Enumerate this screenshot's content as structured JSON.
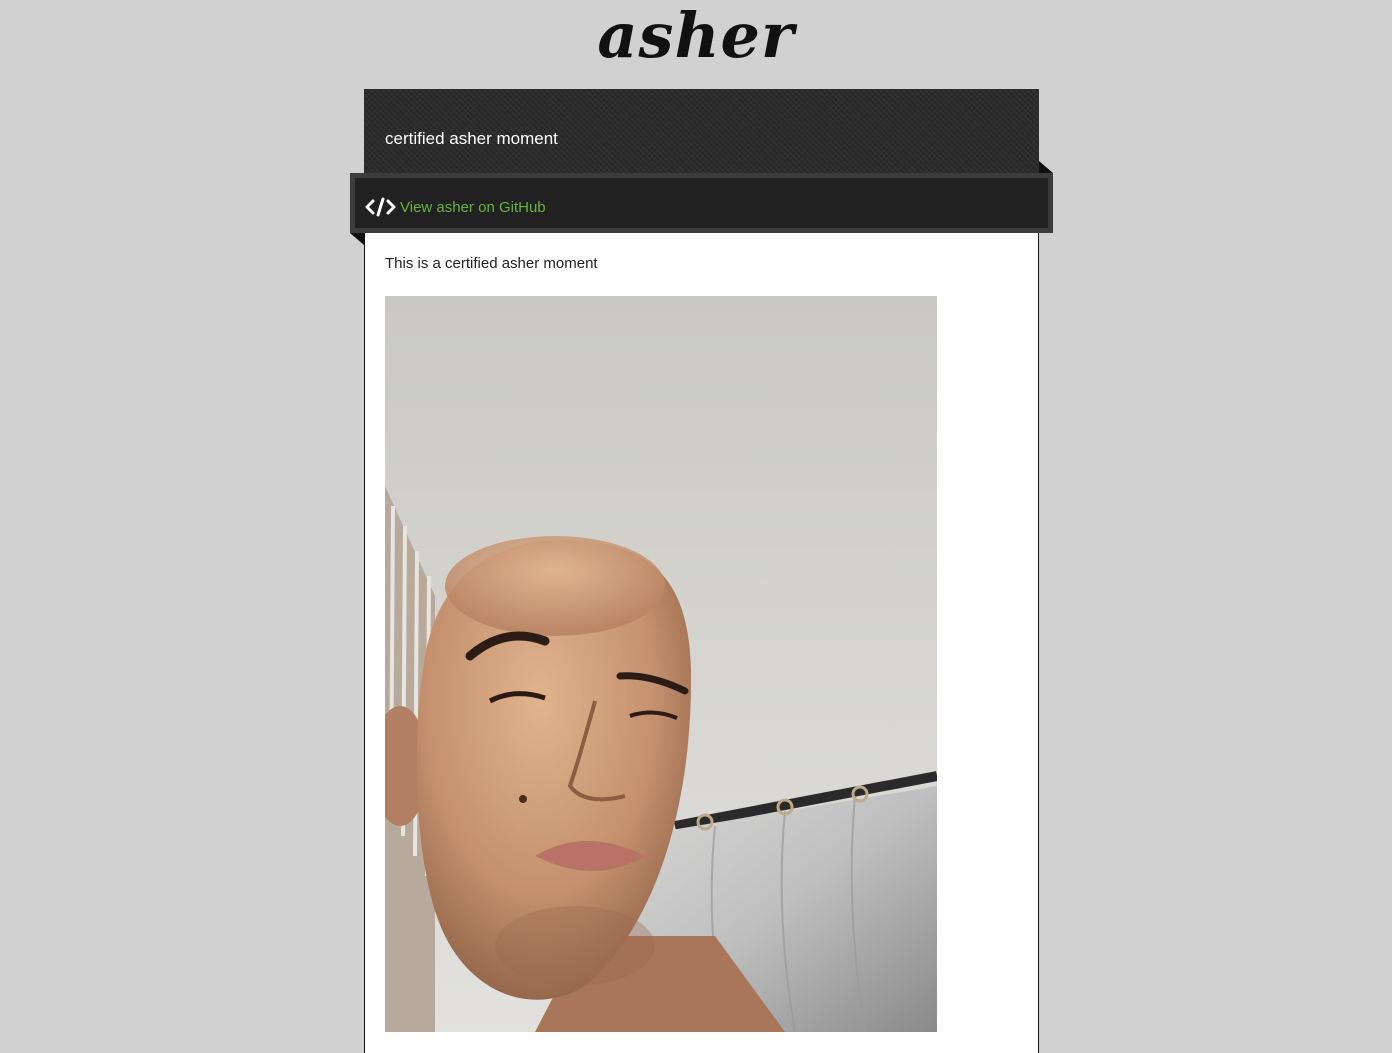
{
  "site": {
    "title": "asher"
  },
  "header": {
    "tagline": "certified asher moment"
  },
  "ribbon": {
    "link_label": "View asher on GitHub",
    "icon": "code-icon",
    "link_color": "#64b33c"
  },
  "main": {
    "text": "This is a certified asher moment",
    "photo_alt": "selfie photo"
  },
  "colors": {
    "page_background": "#d1d1d1",
    "header_background": "#2b2b2b",
    "ribbon_background": "#212121"
  }
}
